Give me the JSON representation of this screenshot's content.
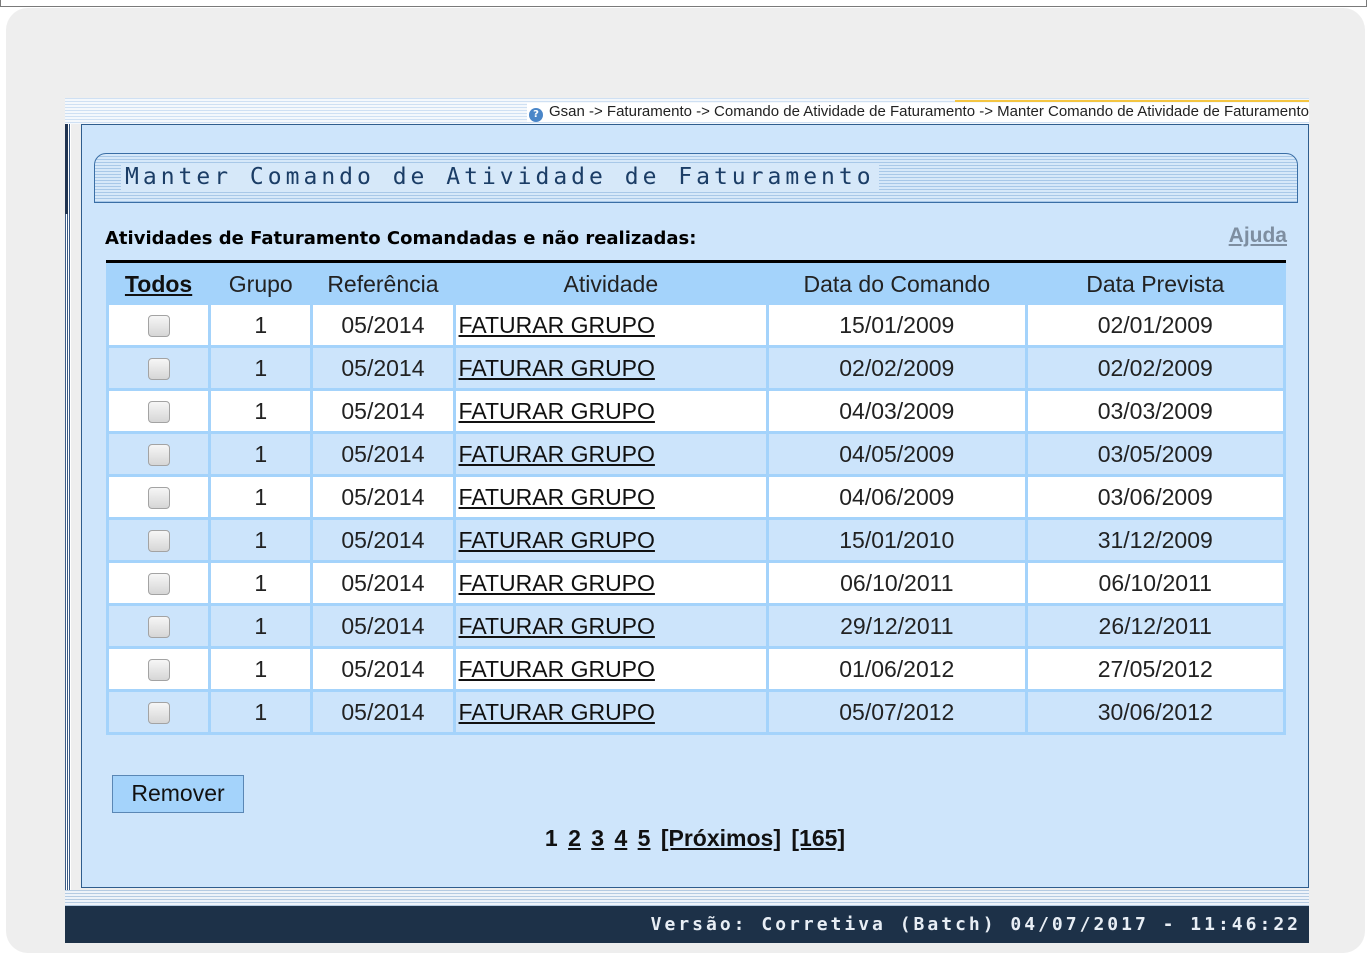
{
  "breadcrumb": "Gsan -> Faturamento -> Comando de Atividade de Faturamento -> Manter Comando de Atividade de Faturamento",
  "page_title": "Manter Comando de Atividade de Faturamento",
  "section_label": "Atividades de Faturamento Comandadas e não realizadas:",
  "help_link": "Ajuda",
  "table": {
    "headers": {
      "todos": "Todos",
      "grupo": "Grupo",
      "referencia": "Referência",
      "atividade": "Atividade",
      "data_comando": "Data do Comando",
      "data_prevista": "Data Prevista"
    },
    "rows": [
      {
        "grupo": "1",
        "referencia": "05/2014",
        "atividade": "FATURAR GRUPO",
        "data_comando": "15/01/2009",
        "data_prevista": "02/01/2009"
      },
      {
        "grupo": "1",
        "referencia": "05/2014",
        "atividade": "FATURAR GRUPO",
        "data_comando": "02/02/2009",
        "data_prevista": "02/02/2009"
      },
      {
        "grupo": "1",
        "referencia": "05/2014",
        "atividade": "FATURAR GRUPO",
        "data_comando": "04/03/2009",
        "data_prevista": "03/03/2009"
      },
      {
        "grupo": "1",
        "referencia": "05/2014",
        "atividade": "FATURAR GRUPO",
        "data_comando": "04/05/2009",
        "data_prevista": "03/05/2009"
      },
      {
        "grupo": "1",
        "referencia": "05/2014",
        "atividade": "FATURAR GRUPO",
        "data_comando": "04/06/2009",
        "data_prevista": "03/06/2009"
      },
      {
        "grupo": "1",
        "referencia": "05/2014",
        "atividade": "FATURAR GRUPO",
        "data_comando": "15/01/2010",
        "data_prevista": "31/12/2009"
      },
      {
        "grupo": "1",
        "referencia": "05/2014",
        "atividade": "FATURAR GRUPO",
        "data_comando": "06/10/2011",
        "data_prevista": "06/10/2011"
      },
      {
        "grupo": "1",
        "referencia": "05/2014",
        "atividade": "FATURAR GRUPO",
        "data_comando": "29/12/2011",
        "data_prevista": "26/12/2011"
      },
      {
        "grupo": "1",
        "referencia": "05/2014",
        "atividade": "FATURAR GRUPO",
        "data_comando": "01/06/2012",
        "data_prevista": "27/05/2012"
      },
      {
        "grupo": "1",
        "referencia": "05/2014",
        "atividade": "FATURAR GRUPO",
        "data_comando": "05/07/2012",
        "data_prevista": "30/06/2012"
      }
    ]
  },
  "remove_button": "Remover",
  "pagination": {
    "current": "1",
    "pages": [
      "2",
      "3",
      "4",
      "5"
    ],
    "next": "[Próximos]",
    "last": "[165]"
  },
  "version": "Versão: Corretiva (Batch) 04/07/2017 - 11:46:22",
  "colors": {
    "panel": "#cee5fb",
    "header": "#a4d3fb",
    "footer": "#1d3148"
  },
  "icons": {
    "breadcrumb": "help-icon"
  }
}
